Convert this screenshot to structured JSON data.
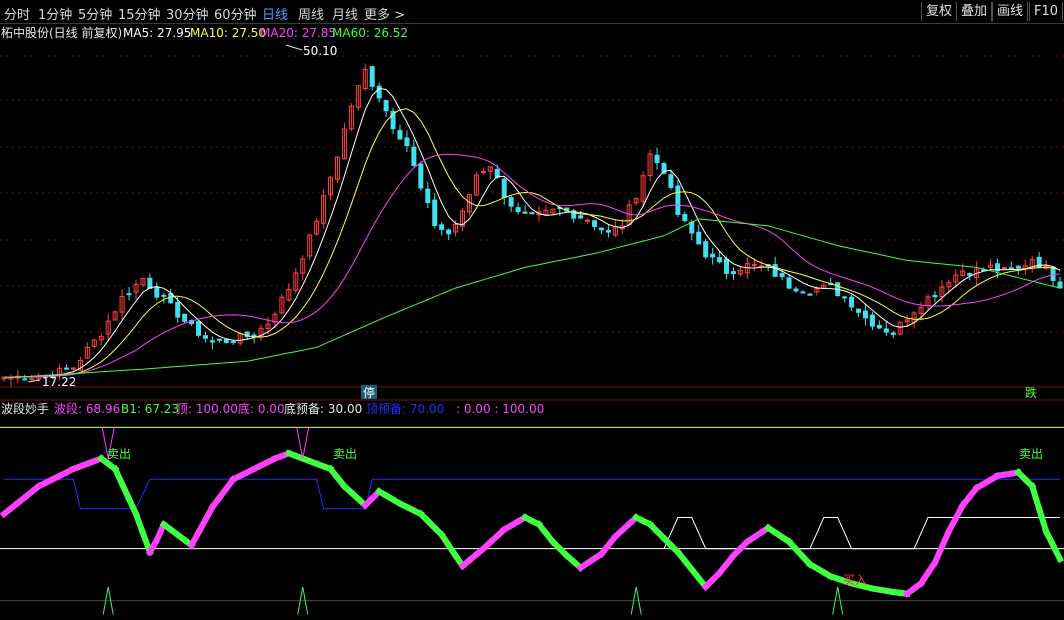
{
  "toolbar": {
    "tabs": [
      "分时",
      "1分钟",
      "5分钟",
      "15分钟",
      "30分钟",
      "60分钟",
      "日线",
      "周线",
      "月线",
      "更多 >"
    ],
    "active_tab": "日线",
    "right_buttons": [
      "复权",
      "叠加",
      "画线",
      "F10"
    ]
  },
  "main_header": {
    "stock": "柘中股份(日线 前复权)",
    "ma5": "MA5: 27.95",
    "ma10": "MA10: 27.50",
    "ma20": "MA20: 27.85",
    "ma60": "MA60: 26.52"
  },
  "main_annotations": {
    "high": "50.10",
    "low": "17.22",
    "halt_marker": "停",
    "drop_marker": "跌"
  },
  "indicator_header": {
    "name": "波段妙手",
    "band": "波段: 68.96",
    "b1": "B1: 67.23",
    "top": "顶: 100.00",
    "bottom": "底: 0.00",
    "bottom_warn": "底预备: 30.00",
    "top_warn": "顶预备: 70.00",
    "extra": ": 0.00 : 100.00"
  },
  "indicator_signals": {
    "sell_1": "卖出",
    "sell_2": "卖出",
    "sell_3": "卖出",
    "buy_1": "买入"
  },
  "colors": {
    "up": "#ff4040",
    "down": "#40e0f0",
    "ma5": "#ffffff",
    "ma10": "#ffff40",
    "ma20": "#ff40ff",
    "ma60": "#40ff40",
    "active_tab": "#3fa0ff",
    "band_up": "#ff40ff",
    "band_down": "#40ff40",
    "top_line": "#ffff00",
    "bottom_line": "#ffffff",
    "warn_line": "#2030ff"
  },
  "chart_data": [
    {
      "type": "candlestick",
      "title": "柘中股份(日线 前复权)",
      "series_names": [
        "MA5",
        "MA10",
        "MA20",
        "MA60"
      ],
      "ma_last": [
        27.95,
        27.5,
        27.85,
        26.52
      ],
      "high": 50.1,
      "low": 17.22,
      "ylim": [
        17,
        51
      ],
      "close_points": [
        [
          0,
          17.5
        ],
        [
          6,
          17.6
        ],
        [
          10,
          18.5
        ],
        [
          14,
          22
        ],
        [
          17,
          25.5
        ],
        [
          20,
          27.5
        ],
        [
          22,
          26
        ],
        [
          24,
          24.6
        ],
        [
          27,
          22.5
        ],
        [
          30,
          21
        ],
        [
          33,
          21.3
        ],
        [
          36,
          21.8
        ],
        [
          38,
          23
        ],
        [
          41,
          26.5
        ],
        [
          44,
          31.5
        ],
        [
          46,
          35.5
        ],
        [
          48,
          40
        ],
        [
          50,
          45
        ],
        [
          52,
          48.5
        ],
        [
          54,
          46
        ],
        [
          56,
          43
        ],
        [
          58,
          41
        ],
        [
          60,
          36.5
        ],
        [
          62,
          33
        ],
        [
          64,
          32
        ],
        [
          66,
          34
        ],
        [
          68,
          38
        ],
        [
          70,
          39
        ],
        [
          72,
          36
        ],
        [
          74,
          34
        ],
        [
          76,
          33.6
        ],
        [
          80,
          34.5
        ],
        [
          84,
          33.5
        ],
        [
          87,
          32
        ],
        [
          89,
          33
        ],
        [
          91,
          36
        ],
        [
          93,
          40
        ],
        [
          95,
          38.5
        ],
        [
          97,
          34
        ],
        [
          99,
          32
        ],
        [
          101,
          30
        ],
        [
          104,
          28.2
        ],
        [
          107,
          28.8
        ],
        [
          110,
          28.5
        ],
        [
          113,
          26.8
        ],
        [
          116,
          26.3
        ],
        [
          119,
          26.6
        ],
        [
          122,
          25
        ],
        [
          124,
          23.5
        ],
        [
          126,
          22.6
        ],
        [
          128,
          22
        ],
        [
          130,
          23.6
        ],
        [
          132,
          25
        ],
        [
          134,
          26
        ],
        [
          136,
          27.4
        ],
        [
          138,
          28.3
        ],
        [
          140,
          28.2
        ],
        [
          142,
          28.6
        ],
        [
          144,
          28.2
        ],
        [
          146,
          28.4
        ],
        [
          148,
          29.5
        ],
        [
          150,
          28.4
        ],
        [
          152,
          26.9
        ]
      ],
      "ma60_points": [
        [
          0,
          17.4
        ],
        [
          20,
          18.3
        ],
        [
          35,
          19.1
        ],
        [
          45,
          20.5
        ],
        [
          55,
          23.6
        ],
        [
          65,
          26.5
        ],
        [
          75,
          28.6
        ],
        [
          85,
          30
        ],
        [
          95,
          31.8
        ],
        [
          100,
          33.5
        ],
        [
          110,
          32.8
        ],
        [
          120,
          30.8
        ],
        [
          130,
          29.3
        ],
        [
          140,
          28.6
        ],
        [
          152,
          26.5
        ]
      ]
    },
    {
      "type": "line",
      "title": "波段妙手",
      "series_names": [
        "波段",
        "B1",
        "顶",
        "底",
        "底预备",
        "顶预备"
      ],
      "last_values": [
        68.96,
        67.23,
        100,
        0,
        30,
        70
      ],
      "ylim": [
        -10,
        110
      ],
      "band_points": [
        [
          0,
          50
        ],
        [
          5,
          66
        ],
        [
          10,
          76
        ],
        [
          14,
          82
        ],
        [
          16,
          76
        ],
        [
          19,
          50
        ],
        [
          21,
          28
        ],
        [
          22,
          35
        ],
        [
          23,
          44
        ],
        [
          25,
          38
        ],
        [
          27,
          32
        ],
        [
          30,
          54
        ],
        [
          33,
          70
        ],
        [
          36,
          76
        ],
        [
          39,
          82
        ],
        [
          41,
          85
        ],
        [
          43,
          82
        ],
        [
          47,
          76
        ],
        [
          49,
          66
        ],
        [
          52,
          55
        ],
        [
          54,
          63
        ],
        [
          57,
          56
        ],
        [
          60,
          50
        ],
        [
          63,
          38
        ],
        [
          66,
          20
        ],
        [
          69,
          30
        ],
        [
          72,
          41
        ],
        [
          75,
          48
        ],
        [
          77,
          44
        ],
        [
          79,
          34
        ],
        [
          81,
          26
        ],
        [
          83,
          19
        ],
        [
          86,
          27
        ],
        [
          88,
          37
        ],
        [
          91,
          48
        ],
        [
          93,
          44
        ],
        [
          95,
          36
        ],
        [
          97,
          28
        ],
        [
          99,
          18
        ],
        [
          101,
          8
        ],
        [
          103,
          16
        ],
        [
          105,
          26
        ],
        [
          107,
          34
        ],
        [
          110,
          42
        ],
        [
          113,
          34
        ],
        [
          116,
          21
        ],
        [
          119,
          14
        ],
        [
          122,
          10
        ],
        [
          125,
          7
        ],
        [
          128,
          5
        ],
        [
          130,
          4
        ],
        [
          132,
          10
        ],
        [
          134,
          22
        ],
        [
          136,
          40
        ],
        [
          138,
          55
        ],
        [
          140,
          65
        ],
        [
          143,
          72
        ],
        [
          146,
          74
        ],
        [
          148,
          66
        ],
        [
          150,
          40
        ],
        [
          152,
          24
        ]
      ],
      "signal_points": [
        15,
        43,
        91,
        120
      ]
    }
  ]
}
